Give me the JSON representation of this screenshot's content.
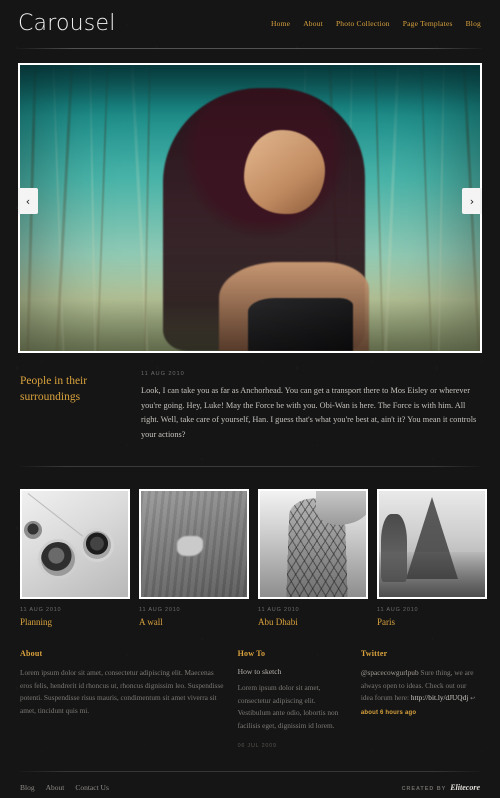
{
  "site": {
    "logo": "Carousel"
  },
  "nav": {
    "items": [
      {
        "label": "Home"
      },
      {
        "label": "About"
      },
      {
        "label": "Photo Collection"
      },
      {
        "label": "Page Templates"
      },
      {
        "label": "Blog"
      }
    ]
  },
  "carousel": {
    "prev_icon": "‹",
    "next_icon": "›",
    "slide_alt": "Portrait of a woman with long dark hair in front of teal reeds"
  },
  "feature": {
    "title": "People in their surroundings",
    "date": "11 AUG 2010",
    "body": "Look, I can take you as far as Anchorhead. You can get a transport there to Mos Eisley or wherever you're going. Hey, Luke! May the Force be with you. Obi-Wan is here. The Force is with him. All right. Well, take care of yourself, Han. I guess that's what you're best at, ain't it? You mean it controls your actions?"
  },
  "thumbnails": [
    {
      "date": "11 AUG 2010",
      "title": "Planning",
      "art": "t1"
    },
    {
      "date": "11 AUG 2010",
      "title": "A wall",
      "art": "t2"
    },
    {
      "date": "11 AUG 2010",
      "title": "Abu Dhabi",
      "art": "t3"
    },
    {
      "date": "11 AUG 2010",
      "title": "Paris",
      "art": "t4"
    }
  ],
  "footer": {
    "about": {
      "heading": "About",
      "text": "Lorem ipsum dolor sit amet, consectetur adipiscing elit. Maecenas eros felis, hendrerit id rhoncus ut, rhoncus dignissim leo. Suspendisse potenti. Suspendisse risus mauris, condimentum sit amet viverra sit amet, tincidunt quis mi."
    },
    "howto": {
      "heading": "How To",
      "post_title": "How to sketch",
      "text": "Lorem ipsum dolor sit amet, consectetur adipiscing elit. Vestibulum ante odio, lobortis non facilisis eget, dignissim id lorem.",
      "date": "06 JUL 2009"
    },
    "twitter": {
      "heading": "Twitter",
      "user": "@spacecowgurlpub",
      "text": " Sure thing, we are always open to ideas. Check out our idea forum here: ",
      "link": "http://bit.ly/dJUQdj",
      "bird_icon": "↩",
      "time": "about 6 hours ago"
    }
  },
  "bottom": {
    "links": [
      {
        "label": "Blog"
      },
      {
        "label": "About"
      },
      {
        "label": "Contact Us"
      }
    ],
    "credit_label": "CREATED BY",
    "credit_brand": "Elitecore"
  },
  "colors": {
    "accent": "#d9a23d",
    "background": "#151515",
    "text": "#c6c2bd",
    "muted": "#6d6d6d"
  }
}
